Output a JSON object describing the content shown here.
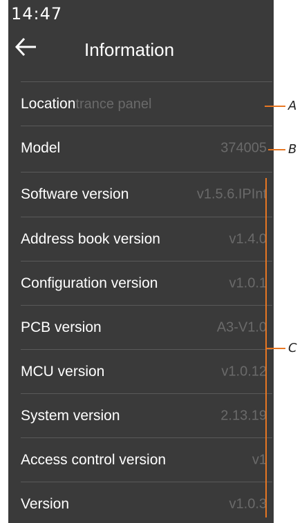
{
  "status_bar": {
    "time": "14:47"
  },
  "header": {
    "back_icon": "arrow-left-icon",
    "title": "Information"
  },
  "location": {
    "label": "Location",
    "value": "trance panel"
  },
  "model": {
    "label": "Model",
    "value": "374005"
  },
  "versions": [
    {
      "label": "Software version",
      "value": "v1.5.6.IPInt"
    },
    {
      "label": "Address book version",
      "value": "v1.4.0"
    },
    {
      "label": "Configuration version",
      "value": "v1.0.1"
    },
    {
      "label": "PCB version",
      "value": "A3-V1.0"
    },
    {
      "label": "MCU version",
      "value": "v1.0.12"
    },
    {
      "label": "System version",
      "value": "2.13.19"
    },
    {
      "label": "Access control version",
      "value": "v1"
    },
    {
      "label": "Version",
      "value": "v1.0.3"
    }
  ],
  "callouts": {
    "a": "A",
    "b": "B",
    "c": "C"
  },
  "colors": {
    "panel_bg": "#3a3a3a",
    "callout": "#e87722",
    "value_text": "#6a6a6a"
  }
}
